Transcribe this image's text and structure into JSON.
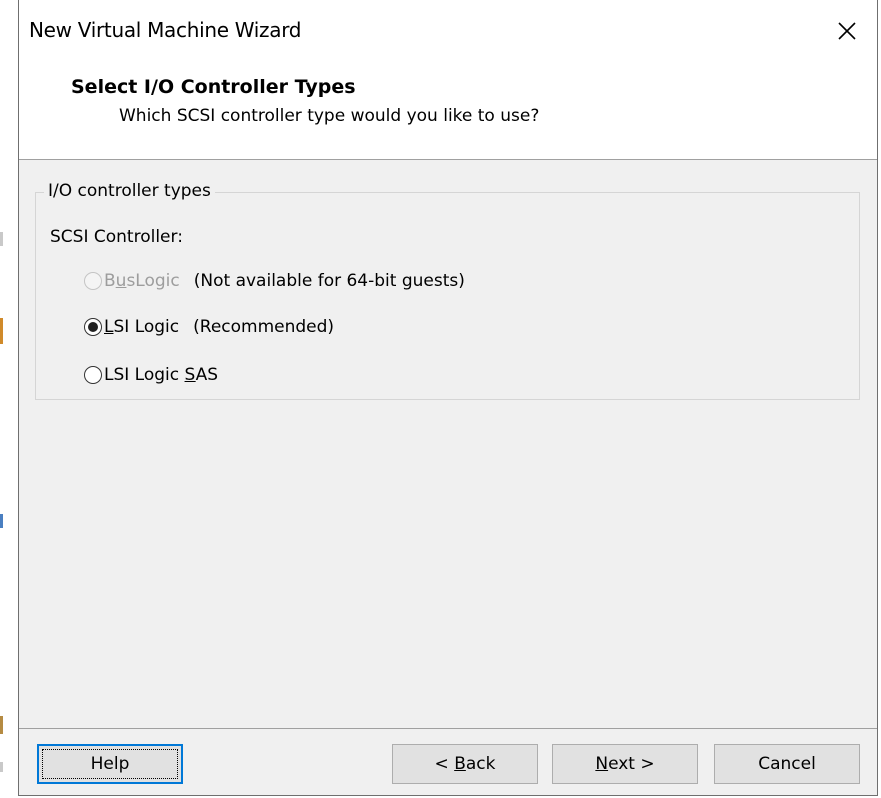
{
  "window": {
    "title": "New Virtual Machine Wizard",
    "close_icon": "close-icon"
  },
  "header": {
    "title": "Select I/O Controller Types",
    "subtitle": "Which SCSI controller type would you like to use?"
  },
  "group": {
    "legend": "I/O controller types",
    "controller_label": "SCSI Controller:",
    "options": [
      {
        "pre": "B",
        "mnemonic": "u",
        "post": "sLogic",
        "note": "(Not available for 64-bit guests)",
        "selected": false,
        "enabled": false
      },
      {
        "pre": "",
        "mnemonic": "L",
        "post": "SI Logic",
        "note": "(Recommended)",
        "selected": true,
        "enabled": true
      },
      {
        "pre": "LSI Logic ",
        "mnemonic": "S",
        "post": "AS",
        "note": "",
        "selected": false,
        "enabled": true
      }
    ]
  },
  "buttons": {
    "help": "Help",
    "back": {
      "pre": "< ",
      "mnemonic": "B",
      "post": "ack"
    },
    "next": {
      "pre": "",
      "mnemonic": "N",
      "post": "ext >"
    },
    "cancel": "Cancel"
  },
  "colors": {
    "focus_border": "#0078d7",
    "dialog_bg": "#f0f0f0",
    "disabled_text": "#9d9d9d"
  }
}
